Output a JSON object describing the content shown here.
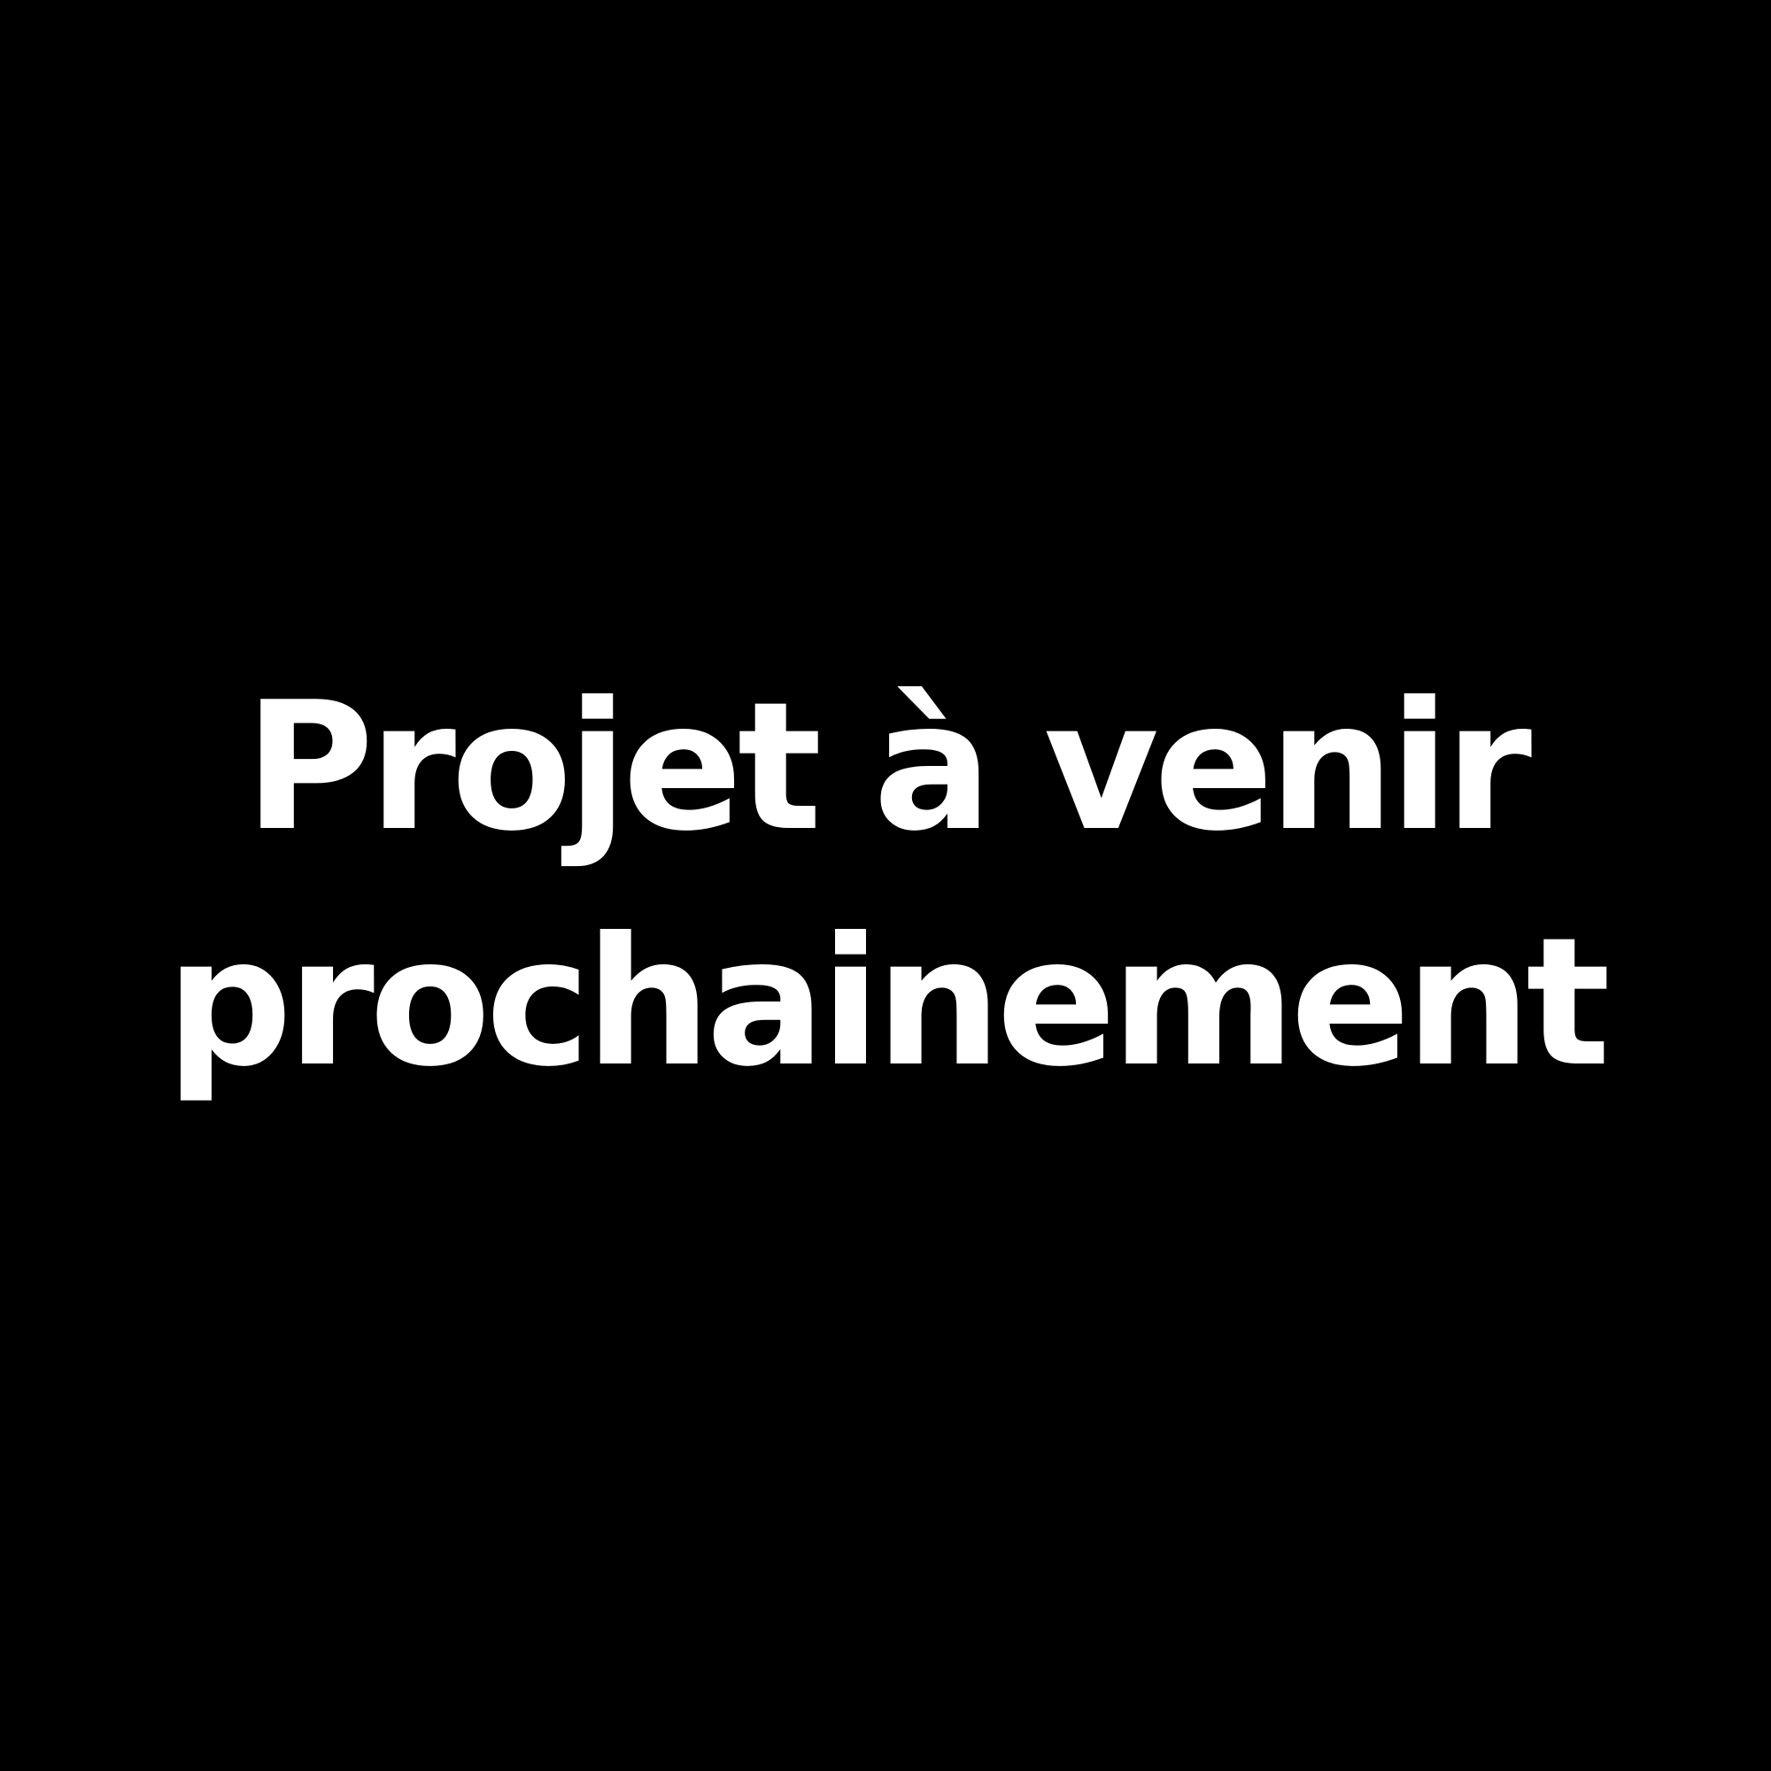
{
  "background_color": "#000000",
  "text_color": "#ffffff",
  "message": {
    "line1": "Projet à venir",
    "line2": "prochainement"
  }
}
